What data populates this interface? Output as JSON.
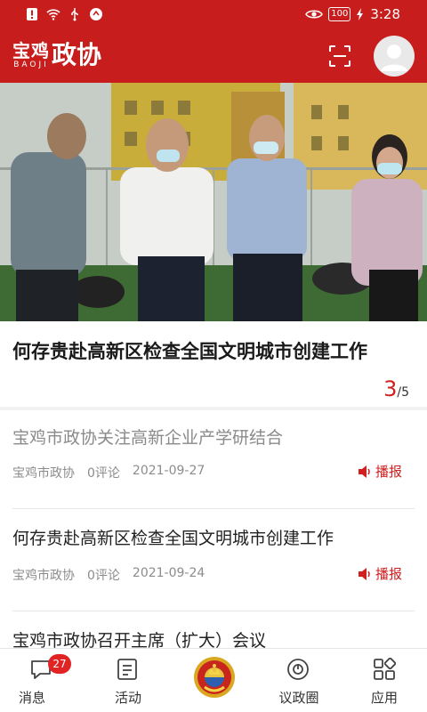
{
  "status_bar": {
    "time": "3:28",
    "battery": "100"
  },
  "header": {
    "brand_small": "宝鸡",
    "brand_en": "BAOJI",
    "brand_big": "政协"
  },
  "banner": {
    "headline": "何存贵赴高新区检查全国文明城市创建工作",
    "page_current": "3",
    "page_total": "/5"
  },
  "news": [
    {
      "title": "宝鸡市政协关注高新企业产学研结合",
      "source": "宝鸡市政协",
      "comments": "0评论",
      "date": "2021-09-27",
      "action": "播报",
      "read": true
    },
    {
      "title": "何存贵赴高新区检查全国文明城市创建工作",
      "source": "宝鸡市政协",
      "comments": "0评论",
      "date": "2021-09-24",
      "action": "播报",
      "read": false
    },
    {
      "title": "宝鸡市政协召开主席（扩大）会议"
    }
  ],
  "bottom_nav": [
    {
      "label": "消息",
      "badge": "27",
      "icon": "message-icon"
    },
    {
      "label": "活动",
      "icon": "activity-icon"
    },
    {
      "label": "",
      "icon": "cppcc-emblem-icon"
    },
    {
      "label": "议政圈",
      "icon": "circle-icon"
    },
    {
      "label": "应用",
      "icon": "apps-icon"
    }
  ],
  "colors": {
    "brand_red": "#c81d1d",
    "accent_red": "#d02020"
  }
}
